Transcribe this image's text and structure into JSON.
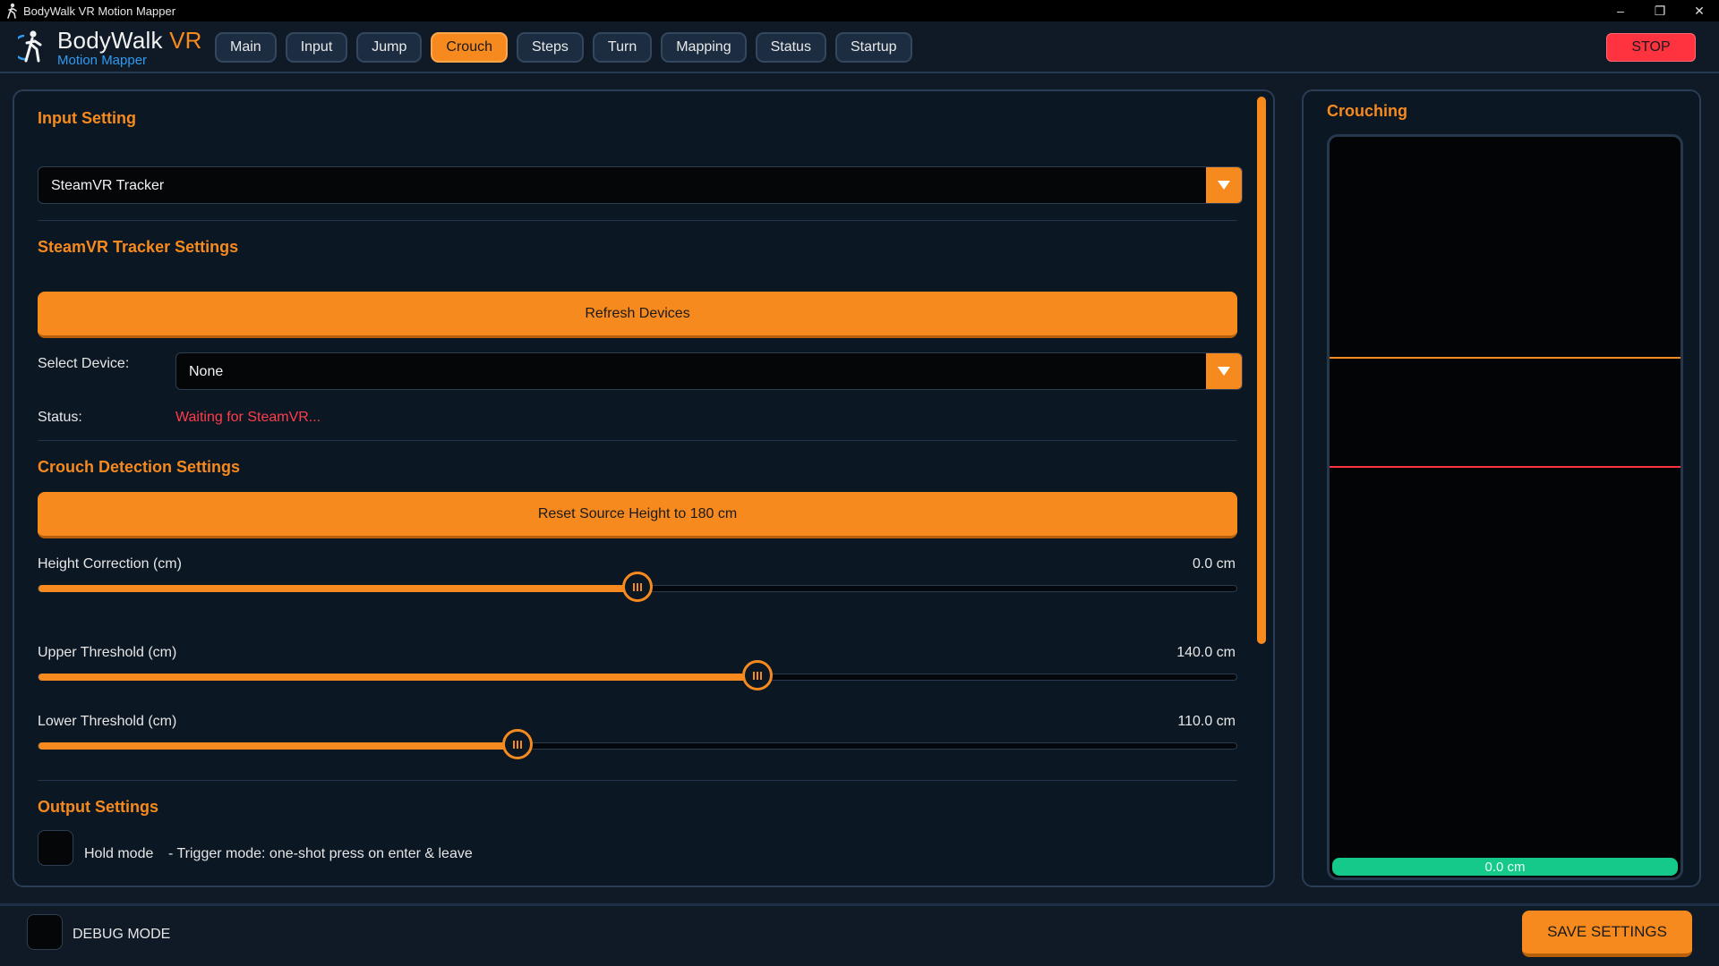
{
  "window": {
    "title": "BodyWalk VR Motion Mapper",
    "controls": {
      "minimize": "–",
      "restore": "❐",
      "close": "✕"
    }
  },
  "header": {
    "logo_main": "BodyWalk",
    "logo_accent": "VR",
    "logo_sub": "Motion Mapper",
    "tabs": [
      {
        "label": "Main"
      },
      {
        "label": "Input"
      },
      {
        "label": "Jump"
      },
      {
        "label": "Crouch"
      },
      {
        "label": "Steps"
      },
      {
        "label": "Turn"
      },
      {
        "label": "Mapping"
      },
      {
        "label": "Status"
      },
      {
        "label": "Startup"
      }
    ],
    "active_tab": "Crouch",
    "stop_label": "STOP"
  },
  "input_setting": {
    "title": "Input Setting",
    "selected": "SteamVR Tracker"
  },
  "tracker_settings": {
    "title": "SteamVR Tracker Settings",
    "refresh_label": "Refresh Devices",
    "select_label": "Select Device:",
    "selected_device": "None",
    "status_label": "Status:",
    "status_value": "Waiting for SteamVR..."
  },
  "crouch_detection": {
    "title": "Crouch Detection Settings",
    "reset_label": "Reset Source Height to 180 cm",
    "sliders": [
      {
        "label": "Height Correction (cm)",
        "value_text": "0.0 cm",
        "fraction": 0.5
      },
      {
        "label": "Upper Threshold (cm)",
        "value_text": "140.0 cm",
        "fraction": 0.6
      },
      {
        "label": "Lower Threshold (cm)",
        "value_text": "110.0 cm",
        "fraction": 0.4
      }
    ]
  },
  "output_settings": {
    "title": "Output Settings",
    "hold_label": "Hold mode",
    "hold_desc": "- Trigger mode: one-shot press on enter & leave",
    "hold_checked": false
  },
  "crouching_panel": {
    "title": "Crouching",
    "current_height": "0.0 cm"
  },
  "footer": {
    "debug_label": "DEBUG MODE",
    "debug_checked": false,
    "save_label": "SAVE SETTINGS"
  },
  "colors": {
    "accent": "#f68a1e",
    "danger": "#ff3340",
    "link_blue": "#2f9bf0",
    "success": "#14c98a",
    "background": "#0f1a26"
  },
  "icons": {
    "app": "bodywalk-figure-icon",
    "dropdown": "triangle-down-icon",
    "slider_thumb": "grip-lines-icon"
  }
}
